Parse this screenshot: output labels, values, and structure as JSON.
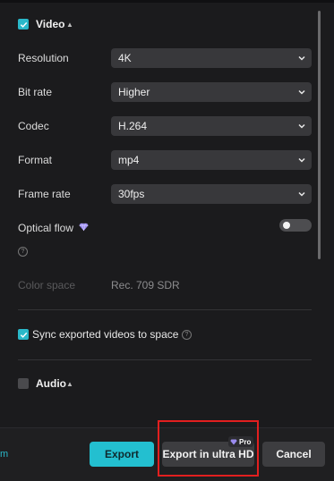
{
  "video_section": {
    "title": "Video",
    "enabled": true
  },
  "settings": [
    {
      "label": "Resolution",
      "value": "4K"
    },
    {
      "label": "Bit rate",
      "value": "Higher"
    },
    {
      "label": "Codec",
      "value": "H.264"
    },
    {
      "label": "Format",
      "value": "mp4"
    },
    {
      "label": "Frame rate",
      "value": "30fps"
    }
  ],
  "optical_flow": {
    "label": "Optical flow",
    "help": "?",
    "enabled": false
  },
  "color_space": {
    "label": "Color space",
    "value": "Rec. 709 SDR"
  },
  "sync": {
    "label": "Sync exported videos to space",
    "checked": true,
    "help": "?"
  },
  "audio_section": {
    "title": "Audio",
    "enabled": false
  },
  "footer": {
    "left_link": "m",
    "export_label": "Export",
    "ultra_label": "Export in ultra HD",
    "pro_badge": "Pro",
    "cancel_label": "Cancel"
  },
  "colors": {
    "accent": "#23bfd0",
    "highlight": "#e21f1f",
    "background": "#1b1b1d",
    "control": "#38383b",
    "premium_icon": "#9b8cf0"
  },
  "icons": {
    "check": "check-icon",
    "collapse": "caret-up-icon",
    "dropdown": "chevron-down-icon",
    "premium": "diamond-icon",
    "help": "question-circle-icon"
  }
}
